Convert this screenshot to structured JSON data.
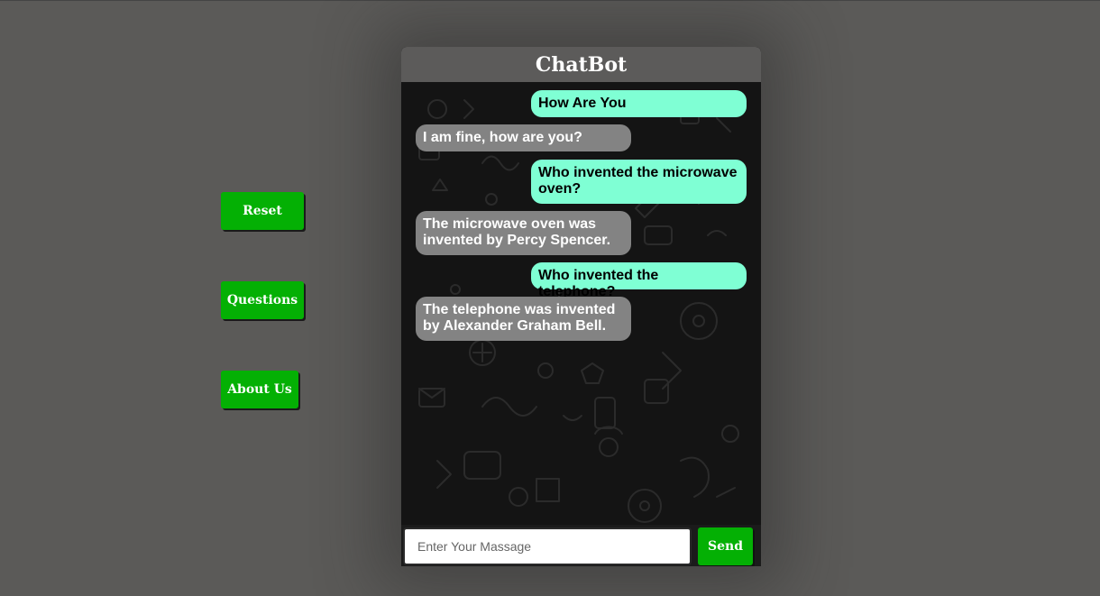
{
  "sidebar": {
    "reset_label": "Reset",
    "questions_label": "Questions",
    "about_label": "About Us"
  },
  "chat": {
    "title": "ChatBot",
    "messages": [
      {
        "sender": "user",
        "text": "How Are You"
      },
      {
        "sender": "bot",
        "text": "I am fine, how are you?"
      },
      {
        "sender": "user",
        "text": "Who invented the microwave oven?"
      },
      {
        "sender": "bot",
        "text": "The microwave oven was invented by Percy Spencer."
      },
      {
        "sender": "user",
        "text": "Who invented the telephone?"
      },
      {
        "sender": "bot",
        "text": "The telephone was invented by Alexander Graham Bell."
      }
    ],
    "input": {
      "placeholder": "Enter Your Massage",
      "value": ""
    },
    "send_label": "Send"
  },
  "colors": {
    "page_background": "#5b5a58",
    "accent_green": "#04b004",
    "user_bubble": "#7fffd4",
    "bot_bubble": "#838383",
    "header": "#5c5b5a",
    "chat_background": "#141414"
  },
  "icons": [
    "doodle-pattern-icon"
  ]
}
